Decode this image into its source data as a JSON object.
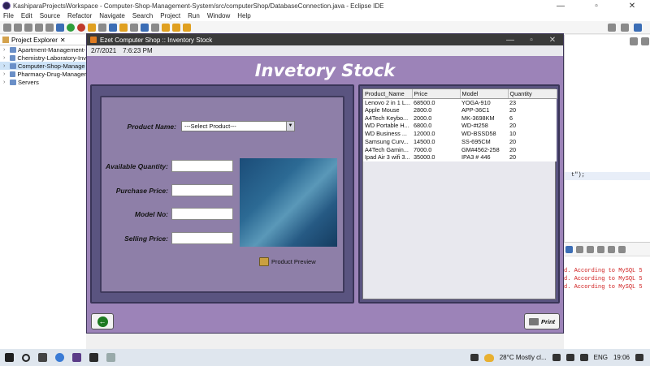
{
  "eclipse": {
    "title": "KashiparaProjectsWorkspace - Computer-Shop-Management-System/src/computerShop/DatabaseConnection.java - Eclipse IDE",
    "menu": [
      "File",
      "Edit",
      "Source",
      "Refactor",
      "Navigate",
      "Search",
      "Project",
      "Run",
      "Window",
      "Help"
    ],
    "window_buttons": [
      "—",
      "▫",
      "✕"
    ],
    "project_explorer": {
      "title": "Project Explorer",
      "close": "✕",
      "items": [
        {
          "label": "Apartment-Management-"
        },
        {
          "label": "Chemistry-Laboratory-Inv"
        },
        {
          "label": "Computer-Shop-Manage"
        },
        {
          "label": "Pharmacy-Drug-Manager"
        },
        {
          "label": "Servers"
        }
      ]
    },
    "code_snippet": "t\");",
    "console_lines": [
      "d. According to MySQL 5",
      "d. According to MySQL 5",
      "d. According to MySQL 5"
    ]
  },
  "app": {
    "title": "Ezet Computer Shop :: Inventory Stock",
    "window_buttons": [
      "—",
      "▫",
      "✕"
    ],
    "date": "2/7/2021",
    "time": "7:6:23 PM",
    "heading": "Invetory Stock",
    "form": {
      "product_name_label": "Product Name:",
      "product_select_value": "---Select Product---",
      "dropdown_arrow": "▼",
      "available_quantity_label": "Available Quantity:",
      "purchase_price_label": "Purchase Price:",
      "model_no_label": "Model No:",
      "selling_price_label": "Selling Price:",
      "product_preview_label": "Product Preview"
    },
    "table": {
      "headers": [
        "Product_Name",
        "Price",
        "Model",
        "Quantity"
      ],
      "rows": [
        [
          "Lenovo 2 in 1 L...",
          "68500.0",
          "YOGA-910",
          "23"
        ],
        [
          "Apple Mouse",
          "2800.0",
          "APP-36C1",
          "20"
        ],
        [
          "A4Tech Keybo...",
          "2000.0",
          "MK-3698KM",
          "6"
        ],
        [
          "WD Portable H...",
          "6800.0",
          "WD-#t258",
          "20"
        ],
        [
          "WD Business ...",
          "12000.0",
          "WD-BSSD58",
          "10"
        ],
        [
          "Samsung Curv...",
          "14500.0",
          "SS-695CM",
          "20"
        ],
        [
          "A4Tech Gamin...",
          "7000.0",
          "GM#4562-258",
          "20"
        ],
        [
          "Ipad Air 3 wifi 3...",
          "35000.0",
          "IPA3 # 446",
          "20"
        ]
      ]
    },
    "back_button_glyph": "←",
    "print_label": "Print"
  },
  "taskbar": {
    "weather": "28°C  Mostly cl...",
    "language": "ENG",
    "clock": "19:06"
  }
}
